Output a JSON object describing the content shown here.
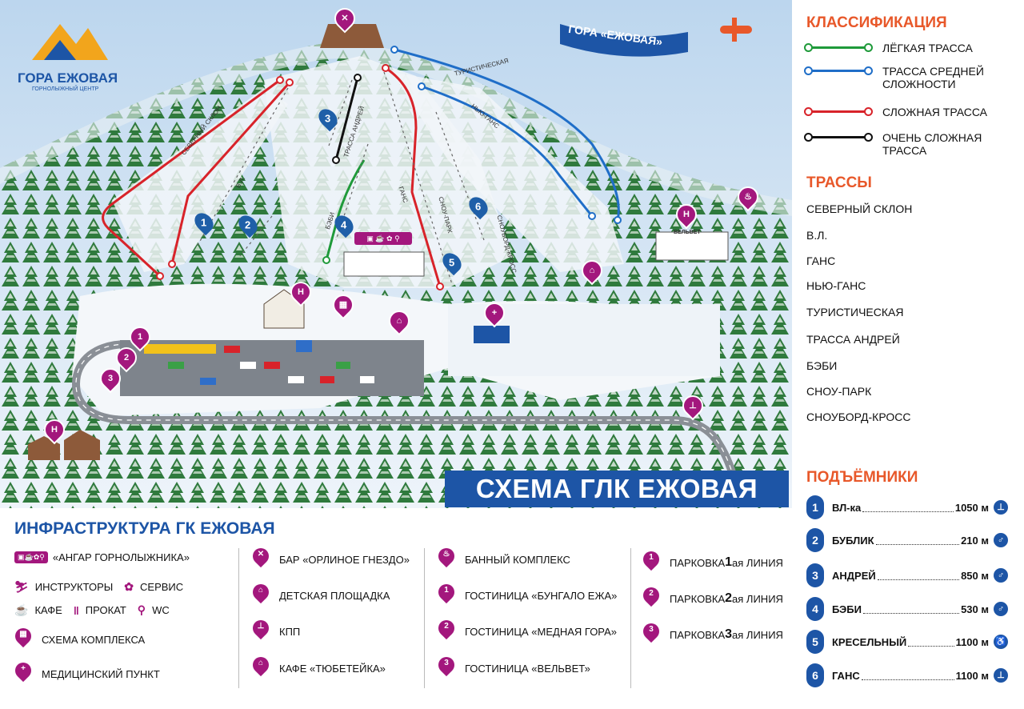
{
  "logo": {
    "name": "ГОРА ЕЖОВАЯ",
    "sub": "ГОРНОЛЫЖНЫЙ ЦЕНТР"
  },
  "banner": "ГОРА «ЕЖОВАЯ»",
  "scheme_title": "СХЕМА ГЛК ЕЖОВАЯ",
  "map_trail_labels": [
    "СЕВЕРНЫЙ СКЛОН",
    "В.Л.",
    "ТРАССА АНДРЕЙ",
    "БЭБИ",
    "ГАНС",
    "СНОУ-ПАРК",
    "СНОУБОРД-КРОСС",
    "НЬЮ-ГАНС",
    "ТУРИСТИЧЕСКАЯ"
  ],
  "map_lift_numbers": [
    "1",
    "2",
    "3",
    "4",
    "5",
    "6"
  ],
  "map_building_sign": "ВЕЛЬВЕТ",
  "classification": {
    "title": "КЛАССИФИКАЦИЯ",
    "items": [
      {
        "label": "ЛЁГКАЯ ТРАССА",
        "color": "#1f9a3a"
      },
      {
        "label": "ТРАССА СРЕДНЕЙ СЛОЖНОСТИ",
        "color": "#1f6ec8"
      },
      {
        "label": "СЛОЖНАЯ ТРАССА",
        "color": "#d8232a"
      },
      {
        "label": "ОЧЕНЬ СЛОЖНАЯ ТРАССА",
        "color": "#111111"
      }
    ]
  },
  "trails": {
    "title": "ТРАССЫ",
    "items": [
      "СЕВЕРНЫЙ СКЛОН",
      "В.Л.",
      "ГАНС",
      "НЬЮ-ГАНС",
      "ТУРИСТИЧЕСКАЯ",
      "ТРАССА АНДРЕЙ",
      "БЭБИ",
      "СНОУ-ПАРК",
      "СНОУБОРД-КРОСС"
    ]
  },
  "lifts": {
    "title": "ПОДЪЁМНИКИ",
    "items": [
      {
        "num": "1",
        "name": "ВЛ-ка",
        "length": "1050 м",
        "type_icon": "t-bar-icon"
      },
      {
        "num": "2",
        "name": "БУБЛИК",
        "length": "210 м",
        "type_icon": "button-lift-icon"
      },
      {
        "num": "3",
        "name": "АНДРЕЙ",
        "length": "850 м",
        "type_icon": "button-lift-icon"
      },
      {
        "num": "4",
        "name": "БЭБИ",
        "length": "530 м",
        "type_icon": "button-lift-icon"
      },
      {
        "num": "5",
        "name": "КРЕСЕЛЬНЫЙ",
        "length": "1100 м",
        "type_icon": "chairlift-icon"
      },
      {
        "num": "6",
        "name": "ГАНС",
        "length": "1100 м",
        "type_icon": "t-bar-icon"
      }
    ]
  },
  "infra": {
    "title": "ИНФРАСТРУКТУРА ГК ЕЖОВАЯ",
    "col1": {
      "hangar": "«АНГАР ГОРНОЛЫЖНИКА»",
      "instructors": "ИНСТРУКТОРЫ",
      "service": "СЕРВИС",
      "cafe": "КАФЕ",
      "rental": "ПРОКАТ",
      "wc": "WC",
      "scheme": "СХЕМА КОМПЛЕКСА",
      "medical": "МЕДИЦИНСКИЙ ПУНКТ"
    },
    "col2": [
      "БАР «ОРЛИНОЕ ГНЕЗДО»",
      "ДЕТСКАЯ ПЛОЩАДКА",
      "КПП",
      "КАФЕ «ТЮБЕТЕЙКА»"
    ],
    "col3": [
      {
        "num": "",
        "label": "БАННЫЙ КОМПЛЕКС"
      },
      {
        "num": "1",
        "label": "ГОСТИНИЦА «БУНГАЛО ЕЖА»"
      },
      {
        "num": "2",
        "label": "ГОСТИНИЦА «МЕДНАЯ ГОРА»"
      },
      {
        "num": "3",
        "label": "ГОСТИНИЦА «ВЕЛЬВЕТ»"
      }
    ],
    "col4": [
      {
        "num": "1",
        "pre": "ПАРКОВКА ",
        "big": "1",
        "post": "ая ЛИНИЯ"
      },
      {
        "num": "2",
        "pre": "ПАРКОВКА ",
        "big": "2",
        "post": "ая ЛИНИЯ"
      },
      {
        "num": "3",
        "pre": "ПАРКОВКА ",
        "big": "3",
        "post": "ая ЛИНИЯ"
      }
    ]
  }
}
